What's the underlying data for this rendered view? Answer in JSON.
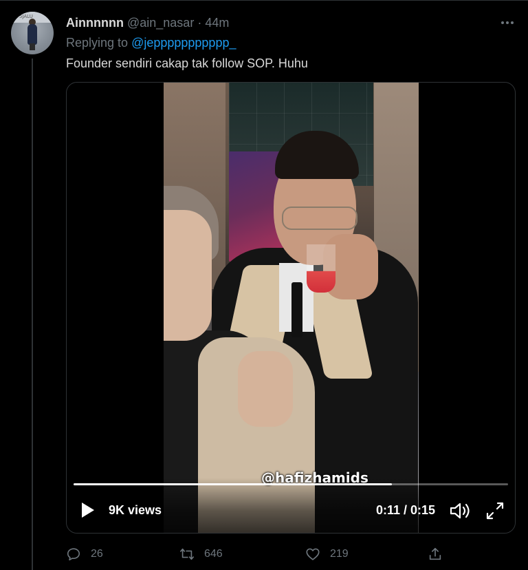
{
  "tweet": {
    "author": {
      "name": "Ainnnnnn",
      "handle": "@ain_nasar",
      "separator": "·",
      "time": "44m"
    },
    "avatar_text": "5JALU",
    "reply": {
      "prefix": "Replying to ",
      "mention": "@jeppppppppppp_"
    },
    "text": "Founder sendiri cakap tak follow SOP. Huhu",
    "more_icon": "more-horizontal-icon"
  },
  "video": {
    "watermark": "@hafizhamids",
    "views": "9K views",
    "timestamp": "0:11 / 0:15",
    "progress_fraction": 0.733,
    "icons": {
      "play": "play-icon",
      "volume": "volume-icon",
      "fullscreen": "fullscreen-icon"
    }
  },
  "actions": {
    "reply_count": "26",
    "retweet_count": "646",
    "like_count": "219",
    "icons": {
      "reply": "reply-icon",
      "retweet": "retweet-icon",
      "like": "heart-icon",
      "share": "share-icon"
    }
  },
  "colors": {
    "background": "#000000",
    "text": "#d9d9d9",
    "muted": "#6e767d",
    "accent": "#1d9bf0",
    "border": "#2f3336"
  }
}
